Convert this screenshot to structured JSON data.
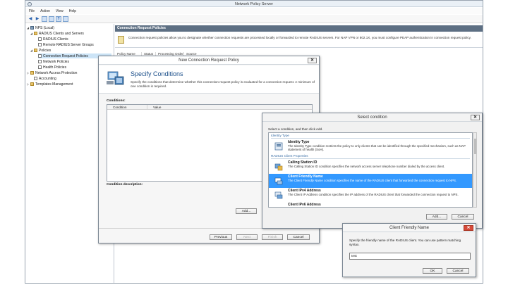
{
  "window": {
    "title": "Network Policy Server"
  },
  "menu": [
    "File",
    "Action",
    "View",
    "Help"
  ],
  "tree": {
    "root": "NPS (Local)",
    "radius_group": "RADIUS Clients and Servers",
    "radius_clients": "RADIUS Clients",
    "remote_groups": "Remote RADIUS Server Groups",
    "policies": "Policies",
    "crp": "Connection Request Policies",
    "network_policies": "Network Policies",
    "health_policies": "Health Policies",
    "nap": "Network Access Protection",
    "accounting": "Accounting",
    "templates": "Templates Management"
  },
  "content": {
    "header": "Connection Request Policies",
    "info": "Connection request policies allow you to designate whether connection requests are processed locally or forwarded to remote RADIUS servers. For NAP VPN or 802.1X, you must configure PEAP authentication in connection request policy.",
    "columns": [
      "Policy Name",
      "Status",
      "Processing Order",
      "Source"
    ]
  },
  "wizard": {
    "title": "New Connection Request Policy",
    "heading": "Specify Conditions",
    "description": "Specify the conditions that determine whether this connection request policy is evaluated for a connection request. A minimum of one condition is required.",
    "conditions_label": "Conditions:",
    "columns": [
      "Condition",
      "Value"
    ],
    "condition_description_label": "Condition description:",
    "add_btn": "Add...",
    "previous_btn": "Previous",
    "next_btn": "Next",
    "finish_btn": "Finish",
    "cancel_btn": "Cancel"
  },
  "select_condition": {
    "title": "Select condition",
    "instruction": "Select a condition, and then click Add.",
    "group_identity": "Identity Type",
    "group_radius": "RADIUS Client Properties",
    "items": [
      {
        "name": "Identity Type",
        "desc": "The Identity Type condition restricts the policy to only clients that can be identified through the specified mechanism, such as NAP statement of health (SoH)."
      },
      {
        "name": "Calling Station ID",
        "desc": "The Calling Station ID condition specifies the network access server telephone number dialed by the access client."
      },
      {
        "name": "Client Friendly Name",
        "desc": "The Client Friendly Name condition specifies the name of the RADIUS client that forwarded the connection request to NPS."
      },
      {
        "name": "Client IPv4 Address",
        "desc": "The Client IP Address condition specifies the IP address of the RADIUS client that forwarded the connection request to NPS."
      },
      {
        "name": "Client IPv6 Address",
        "desc": ""
      }
    ],
    "add_btn": "Add...",
    "cancel_btn": "Cancel"
  },
  "client_friendly_name": {
    "title": "Client Friendly Name",
    "description": "Specify the friendly name of the RADIUS client. You can use pattern matching syntax.",
    "value": "test",
    "ok_btn": "OK",
    "cancel_btn": "Cancel"
  },
  "colors": {
    "accent": "#3399ff",
    "header": "#5d6f83",
    "close_red": "#d64a3a"
  }
}
